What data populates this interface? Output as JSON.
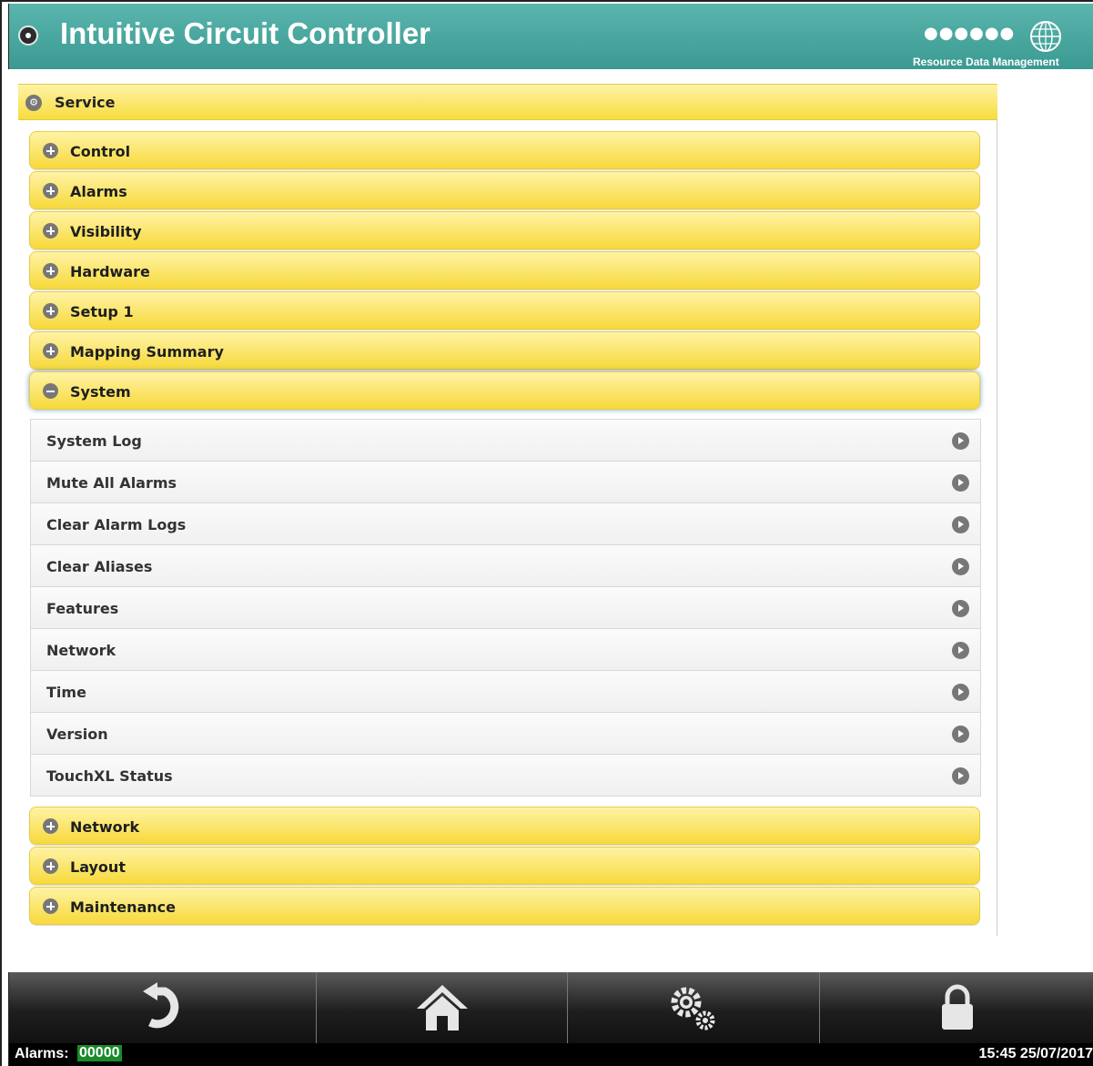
{
  "header": {
    "title": "Intuitive Circuit Controller",
    "brand_text": "Resource Data Management",
    "brand_dots": "●●●●●●"
  },
  "service": {
    "label": "Service",
    "sections_top": [
      {
        "label": "Control",
        "icon": "plus-circle-icon"
      },
      {
        "label": "Alarms",
        "icon": "plus-circle-icon"
      },
      {
        "label": "Visibility",
        "icon": "plus-circle-icon"
      },
      {
        "label": "Hardware",
        "icon": "plus-circle-icon"
      },
      {
        "label": "Setup 1",
        "icon": "plus-circle-icon"
      },
      {
        "label": "Mapping Summary",
        "icon": "plus-circle-icon"
      },
      {
        "label": "System",
        "icon": "minus-circle-icon",
        "expanded": true
      }
    ],
    "system_items": [
      "System Log",
      "Mute All Alarms",
      "Clear Alarm Logs",
      "Clear Aliases",
      "Features",
      "Network",
      "Time",
      "Version",
      "TouchXL Status"
    ],
    "sections_bottom": [
      {
        "label": "Network",
        "icon": "plus-circle-icon"
      },
      {
        "label": "Layout",
        "icon": "plus-circle-icon"
      },
      {
        "label": "Maintenance",
        "icon": "plus-circle-icon"
      }
    ]
  },
  "toolbar": {
    "buttons": [
      "back-icon",
      "home-icon",
      "settings-gears-icon",
      "lock-icon"
    ]
  },
  "status": {
    "alarms_label": "Alarms:",
    "alarms_count": "00000",
    "datetime": "15:45 25/07/2017"
  },
  "colors": {
    "header_teal": "#46a39b",
    "section_yellow": "#f7dc3e",
    "toolbar_dark": "#1e1e1e",
    "alarm_green": "#1a8a2a"
  }
}
